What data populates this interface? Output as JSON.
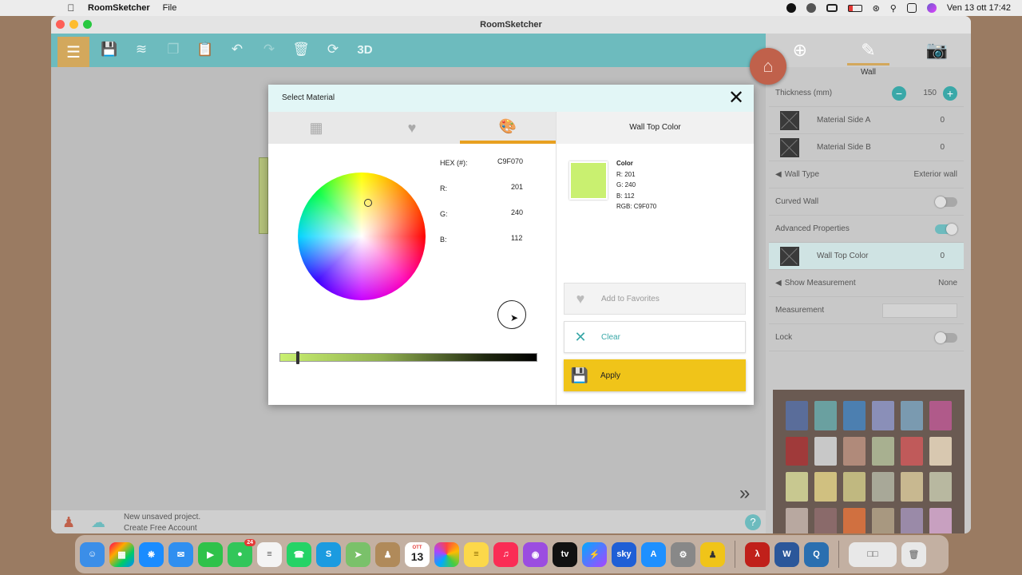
{
  "menubar": {
    "app_name": "RoomSketcher",
    "menu_file": "File",
    "datetime": "Ven 13 ott  17:42"
  },
  "window": {
    "title": "RoomSketcher"
  },
  "toolbar": {
    "button_3d": "3D"
  },
  "panel": {
    "title": "Wall",
    "thickness_label": "Thickness (mm)",
    "thickness_value": "150",
    "material_a_label": "Material Side A",
    "material_a_value": "0",
    "material_b_label": "Material Side B",
    "material_b_value": "0",
    "wall_type_label": "Wall Type",
    "wall_type_value": "Exterior wall",
    "curved_wall_label": "Curved Wall",
    "curved_wall_on": false,
    "advanced_label": "Advanced Properties",
    "advanced_on": true,
    "wall_top_color_label": "Wall Top Color",
    "wall_top_color_value": "0",
    "show_measurement_label": "Show Measurement",
    "show_measurement_value": "None",
    "measurement_label": "Measurement",
    "lock_label": "Lock",
    "lock_on": false
  },
  "status": {
    "line1": "New unsaved project.",
    "line2": "Create Free Account"
  },
  "dialog": {
    "title": "Select Material",
    "right_header": "Wall Top Color",
    "hex_label": "HEX (#):",
    "hex_value": "C9F070",
    "r_label": "R:",
    "r_value": "201",
    "g_label": "G:",
    "g_value": "240",
    "b_label": "B:",
    "b_value": "112",
    "swatch_color": "#C9F070",
    "info_title": "Color",
    "info_r": "R: 201",
    "info_g": "G: 240",
    "info_b": "B: 112",
    "info_rgb": "RGB: C9F070",
    "add_favorites": "Add to Favorites",
    "clear": "Clear",
    "apply": "Apply"
  },
  "dock": {
    "calendar_month": "OTT",
    "calendar_day": "13",
    "messages_badge": "24",
    "sky_label": "sky"
  },
  "colors": {
    "accent_teal": "#6dbbbe",
    "apply_yellow": "#f0c419",
    "tab_underline": "#e8a020",
    "fab": "#c0614b"
  }
}
